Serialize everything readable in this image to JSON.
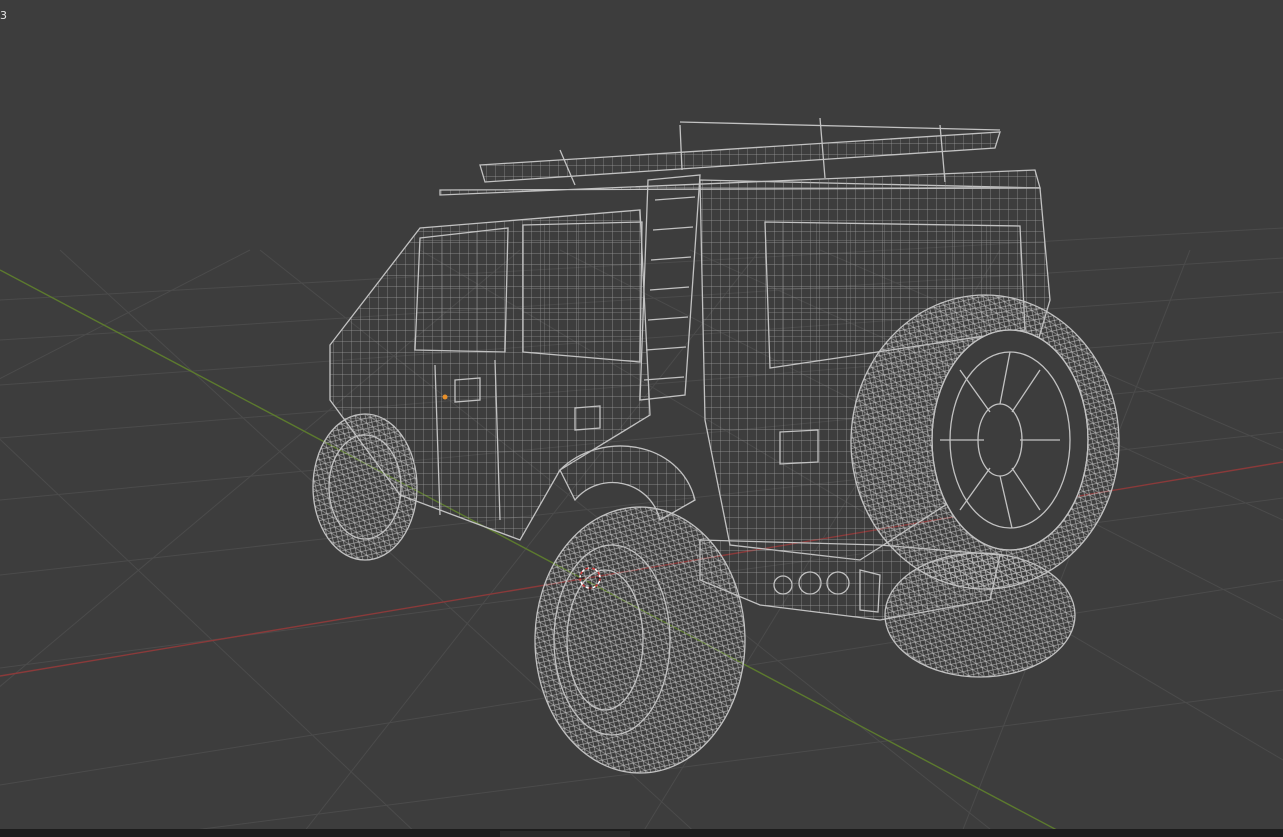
{
  "viewport": {
    "corner_label": "3",
    "view_mode": "wireframe",
    "grid_visible": true,
    "colors": {
      "background": "#3d3d3d",
      "grid": "#4a4a4a",
      "x_axis": "#8a3a3a",
      "y_axis": "#5c7a2e",
      "wireframe": "#bdbdbd",
      "cursor": "#d23c3c",
      "origin_dot": "#e8902a"
    },
    "objects": [
      {
        "name": "off-road-suv",
        "description_icon": "mesh-icon"
      }
    ]
  }
}
